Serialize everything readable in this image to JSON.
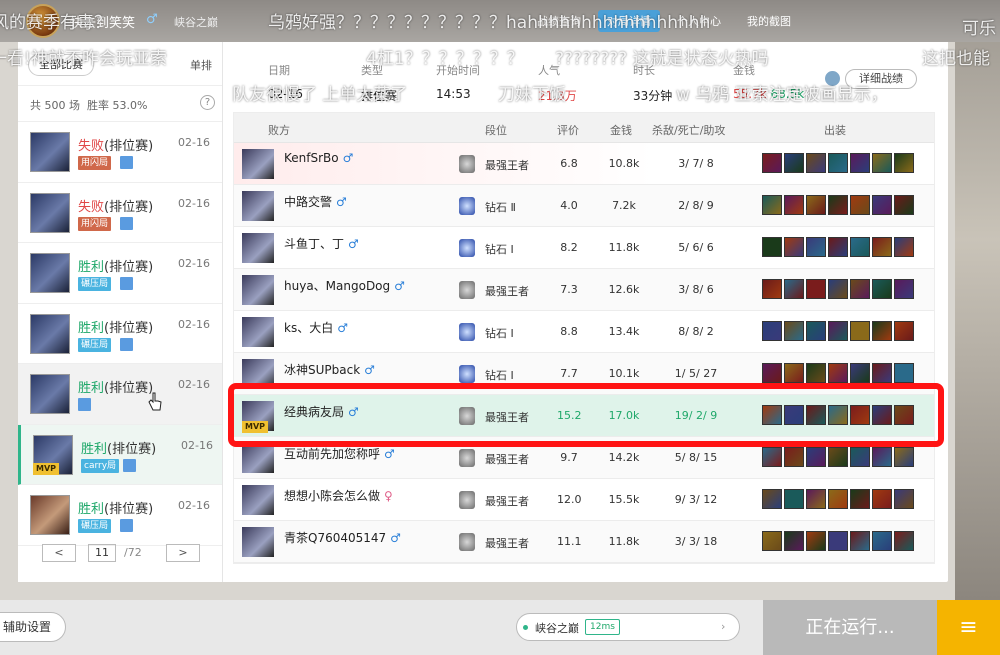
{
  "topbar": {
    "name": "快去到笑笑",
    "gender": "♂",
    "region": "峡谷之巅",
    "nav": [
      "战绩查询",
      "对局详情",
      "个人中心",
      "我的截图"
    ],
    "active_nav": 1
  },
  "sidebar": {
    "filter_label": "全部比赛",
    "mode_label": "单排",
    "total": "共 500 场",
    "winrate": "胜率 53.0%",
    "help": "?",
    "matches": [
      {
        "result": "失败",
        "type": "(排位赛)",
        "date": "02-16",
        "tag": "用闪局",
        "outcome": "loss"
      },
      {
        "result": "失败",
        "type": "(排位赛)",
        "date": "02-16",
        "tag": "用闪局",
        "outcome": "loss"
      },
      {
        "result": "胜利",
        "type": "(排位赛)",
        "date": "02-16",
        "tag": "碾压局",
        "outcome": "win"
      },
      {
        "result": "胜利",
        "type": "(排位赛)",
        "date": "02-16",
        "tag": "碾压局",
        "outcome": "win"
      },
      {
        "result": "胜利",
        "type": "(排位赛)",
        "date": "02-16",
        "tag": "",
        "outcome": "win"
      },
      {
        "result": "胜利",
        "type": "(排位赛)",
        "date": "02-16",
        "tag": "carry局",
        "outcome": "win",
        "mvp": "MVP"
      },
      {
        "result": "胜利",
        "type": "(排位赛)",
        "date": "02-16",
        "tag": "碾压局",
        "outcome": "win"
      }
    ],
    "pager": {
      "prev": "<",
      "current": "11",
      "total": "/72",
      "next": ">"
    }
  },
  "summary": {
    "date_label": "日期",
    "date": "02-16",
    "type_label": "类型",
    "type": "排位赛",
    "start_label": "开始时间",
    "start": "14:53",
    "pop_label": "人气",
    "pop": "21.3万",
    "dur_label": "时长",
    "dur": "33分钟",
    "gold_label": "金钱",
    "gold_a": "55.7k",
    "gold_b": "68.5k",
    "detail_btn": "详细战绩"
  },
  "table": {
    "headers": {
      "team": "败方",
      "rank": "段位",
      "score": "评价",
      "gold": "金钱",
      "kda": "杀敌/死亡/助攻",
      "items": "出装"
    },
    "rows": [
      {
        "name": "KenfSrBo",
        "gender": "♂",
        "rank": "最强王者",
        "tier": "master",
        "score": "6.8",
        "gold": "10.8k",
        "kda": "3/ 7/ 8"
      },
      {
        "name": "中路交警",
        "gender": "♂",
        "rank": "钻石 Ⅱ",
        "tier": "diamond",
        "score": "4.0",
        "gold": "7.2k",
        "kda": "2/ 8/ 9"
      },
      {
        "name": "斗鱼丁、丁",
        "gender": "♂",
        "rank": "钻石 Ⅰ",
        "tier": "diamond",
        "score": "8.2",
        "gold": "11.8k",
        "kda": "5/ 6/ 6"
      },
      {
        "name": "huya、MangoDog",
        "gender": "♂",
        "rank": "最强王者",
        "tier": "master",
        "score": "7.3",
        "gold": "12.6k",
        "kda": "3/ 8/ 6"
      },
      {
        "name": "ks、大白",
        "gender": "♂",
        "rank": "钻石 Ⅰ",
        "tier": "diamond",
        "score": "8.8",
        "gold": "13.4k",
        "kda": "8/ 8/ 2"
      },
      {
        "name": "冰神SUPback",
        "gender": "♂",
        "rank": "钻石 Ⅰ",
        "tier": "diamond",
        "score": "7.7",
        "gold": "10.1k",
        "kda": "1/ 5/ 27"
      },
      {
        "name": "经典病友局",
        "gender": "♂",
        "rank": "最强王者",
        "tier": "master",
        "score": "15.2",
        "gold": "17.0k",
        "kda": "19/ 2/ 9",
        "mvp": "MVP"
      },
      {
        "name": "互动前先加您称呼",
        "gender": "♂",
        "rank": "最强王者",
        "tier": "master",
        "score": "9.7",
        "gold": "14.2k",
        "kda": "5/ 8/ 15"
      },
      {
        "name": "想想小陈会怎么做",
        "gender": "♀",
        "rank": "最强王者",
        "tier": "master",
        "score": "12.0",
        "gold": "15.5k",
        "kda": "9/ 3/ 12"
      },
      {
        "name": "青茶Q760405147",
        "gender": "♂",
        "rank": "最强王者",
        "tier": "master",
        "score": "11.1",
        "gold": "11.8k",
        "kda": "3/ 3/ 18"
      }
    ]
  },
  "bottombar": {
    "assist": "辅助设置",
    "server": "峡谷之巅",
    "ping": "12ms",
    "running": "正在运行...",
    "menu": "≡"
  },
  "danmaku": [
    "风的赛季有毒？",
    "乌鸦好强？？？？？？？？？？hahhhhhhhhhhhhhhhhh",
    "可乐",
    "一看!神就不咋会玩亚索",
    "4杠1？？？？？？？",
    "???????? 这就是状态火热吗",
    "这把也能",
    "队友很慢了 上单太菜了",
    "刀妹下饭",
    "w 乌鸦 亚索注定被画显示，"
  ],
  "colors": {
    "win": "#1fa86a",
    "loss": "#e04848",
    "highlight": "#ff1414",
    "accent": "#f5b400"
  }
}
